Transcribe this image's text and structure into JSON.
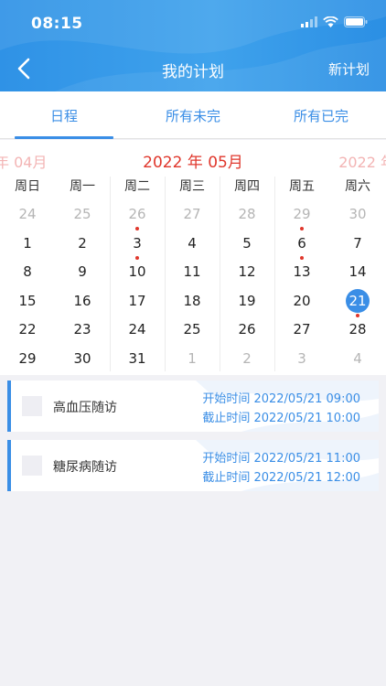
{
  "status_bar": {
    "time": "08:15"
  },
  "nav": {
    "title": "我的计划",
    "right_action": "新计划"
  },
  "tabs": [
    {
      "label": "日程",
      "active": true
    },
    {
      "label": "所有未完",
      "active": false
    },
    {
      "label": "所有已完",
      "active": false
    }
  ],
  "calendar": {
    "prev_month": "年 04月",
    "current_month": "2022 年 05月",
    "next_month": "2022 年",
    "weekdays": [
      "周日",
      "周一",
      "周二",
      "周三",
      "周四",
      "周五",
      "周六"
    ],
    "weeks": [
      [
        {
          "d": "24",
          "m": "other"
        },
        {
          "d": "25",
          "m": "other"
        },
        {
          "d": "26",
          "m": "other",
          "dot": true
        },
        {
          "d": "27",
          "m": "other"
        },
        {
          "d": "28",
          "m": "other"
        },
        {
          "d": "29",
          "m": "other",
          "dot": true
        },
        {
          "d": "30",
          "m": "other"
        }
      ],
      [
        {
          "d": "1",
          "m": "cur"
        },
        {
          "d": "2",
          "m": "cur"
        },
        {
          "d": "3",
          "m": "cur",
          "dot": true
        },
        {
          "d": "4",
          "m": "cur"
        },
        {
          "d": "5",
          "m": "cur"
        },
        {
          "d": "6",
          "m": "cur",
          "dot": true
        },
        {
          "d": "7",
          "m": "cur"
        }
      ],
      [
        {
          "d": "8",
          "m": "cur"
        },
        {
          "d": "9",
          "m": "cur"
        },
        {
          "d": "10",
          "m": "cur"
        },
        {
          "d": "11",
          "m": "cur"
        },
        {
          "d": "12",
          "m": "cur"
        },
        {
          "d": "13",
          "m": "cur"
        },
        {
          "d": "14",
          "m": "cur"
        }
      ],
      [
        {
          "d": "15",
          "m": "cur"
        },
        {
          "d": "16",
          "m": "cur"
        },
        {
          "d": "17",
          "m": "cur"
        },
        {
          "d": "18",
          "m": "cur"
        },
        {
          "d": "19",
          "m": "cur"
        },
        {
          "d": "20",
          "m": "cur"
        },
        {
          "d": "21",
          "m": "cur",
          "selected": true,
          "dot": true
        }
      ],
      [
        {
          "d": "22",
          "m": "cur"
        },
        {
          "d": "23",
          "m": "cur"
        },
        {
          "d": "24",
          "m": "cur"
        },
        {
          "d": "25",
          "m": "cur"
        },
        {
          "d": "26",
          "m": "cur"
        },
        {
          "d": "27",
          "m": "cur"
        },
        {
          "d": "28",
          "m": "cur"
        }
      ],
      [
        {
          "d": "29",
          "m": "cur"
        },
        {
          "d": "30",
          "m": "cur"
        },
        {
          "d": "31",
          "m": "cur"
        },
        {
          "d": "1",
          "m": "other"
        },
        {
          "d": "2",
          "m": "other"
        },
        {
          "d": "3",
          "m": "other"
        },
        {
          "d": "4",
          "m": "other"
        }
      ]
    ]
  },
  "plans": [
    {
      "title": "高血压随访",
      "start": "开始时间 2022/05/21 09:00",
      "end": "截止时间 2022/05/21 10:00"
    },
    {
      "title": "糖尿病随访",
      "start": "开始时间 2022/05/21 11:00",
      "end": "截止时间 2022/05/21 12:00"
    }
  ],
  "colors": {
    "accent": "#3a8ee6",
    "event_dot": "#e0372c",
    "header": "#3fa2ec"
  },
  "icons": {
    "back": "chevron-left-icon",
    "signal": "signal-icon",
    "wifi": "wifi-icon",
    "battery": "battery-icon"
  }
}
